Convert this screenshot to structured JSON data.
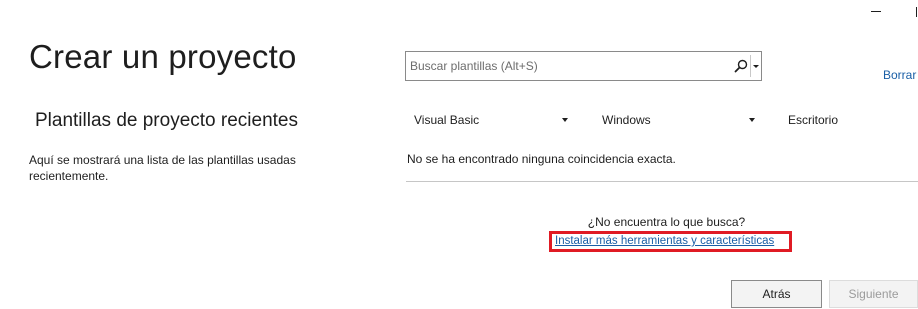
{
  "page": {
    "title": "Crear un proyecto"
  },
  "recent": {
    "title": "Plantillas de proyecto recientes",
    "description": "Aquí se mostrará una lista de las plantillas usadas recientemente."
  },
  "search": {
    "placeholder": "Buscar plantillas (Alt+S)",
    "value": "",
    "icon": "search-icon",
    "dropdown_icon": "chevron-down-icon"
  },
  "clear_filters_label": "Borrar",
  "filters": {
    "language": "Visual Basic",
    "platform": "Windows",
    "project_type": "Escritorio"
  },
  "results": {
    "empty_message": "No se ha encontrado ninguna coincidencia exacta."
  },
  "help": {
    "question": "¿No encuentra lo que busca?",
    "install_link": "Instalar más herramientas y características"
  },
  "buttons": {
    "back": "Atrás",
    "next": "Siguiente"
  },
  "colors": {
    "link": "#1a5fa6",
    "highlight": "#e01b24",
    "disabled_text": "#9b9b9b"
  }
}
